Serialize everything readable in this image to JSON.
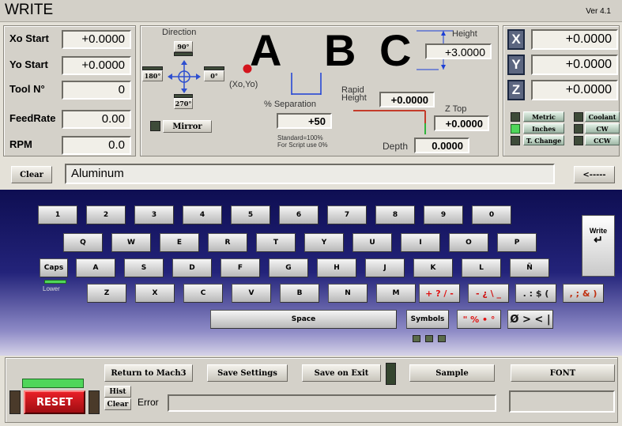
{
  "title": "WRITE",
  "version": "Ver 4.1",
  "left_fields": [
    {
      "label": "Xo Start",
      "value": "+0.0000"
    },
    {
      "label": "Yo Start",
      "value": "+0.0000"
    },
    {
      "label": "Tool N°",
      "value": "0"
    },
    {
      "label": "FeedRate",
      "value": "0.00"
    },
    {
      "label": "RPM",
      "value": "0.0"
    }
  ],
  "direction": {
    "label": "Direction",
    "up": "90°",
    "left": "180°",
    "right": "0°",
    "down": "270°",
    "mirror": "Mirror"
  },
  "preview": {
    "letters": [
      "A",
      "B",
      "C"
    ],
    "origin": "(Xo,Yo)",
    "height_label": "Height",
    "height_value": "+3.0000",
    "separation_label": "% Separation",
    "separation_value": "+50",
    "sep_note1": "Standard=100%",
    "sep_note2": "For Script use 0%",
    "rapid_label1": "Rapid",
    "rapid_label2": "Height",
    "rapid_value": "+0.0000",
    "ztop_label": "Z Top",
    "ztop_value": "+0.0000",
    "depth_label": "Depth",
    "depth_value": "0.0000"
  },
  "axes": [
    {
      "name": "X",
      "value": "+0.0000"
    },
    {
      "name": "Y",
      "value": "+0.0000"
    },
    {
      "name": "Z",
      "value": "+0.0000"
    }
  ],
  "units": {
    "metric": "Metric",
    "inches": "Inches",
    "tchange": "T. Change",
    "coolant": "Coolant",
    "cw": "CW",
    "ccw": "CCW"
  },
  "text_line": {
    "clear": "Clear",
    "value": "Aluminum",
    "back": "<-----"
  },
  "keyboard": {
    "row1": [
      "1",
      "2",
      "3",
      "4",
      "5",
      "6",
      "7",
      "8",
      "9",
      "0"
    ],
    "row2": [
      "Q",
      "W",
      "E",
      "R",
      "T",
      "Y",
      "U",
      "I",
      "O",
      "P"
    ],
    "caps": "Caps",
    "row3": [
      "A",
      "S",
      "D",
      "F",
      "G",
      "H",
      "J",
      "K",
      "L",
      "Ñ"
    ],
    "lower": "Lower",
    "row4": [
      "Z",
      "X",
      "C",
      "V",
      "B",
      "N",
      "M"
    ],
    "space": "Space",
    "symbols": "Symbols",
    "write": "Write",
    "sym1": "+ ? / -",
    "sym2": "- ¿ \\ _",
    "sym3": ". : $ (",
    "sym4": ", ; & )",
    "sym5": "\" % • °",
    "sym6": "Ø > < |"
  },
  "bottom": {
    "return": "Return to Mach3",
    "save_settings": "Save Settings",
    "save_exit": "Save on Exit",
    "sample": "Sample",
    "font": "FONT",
    "reset": "RESET",
    "hist": "Hist",
    "clear": "Clear",
    "error_label": "Error"
  },
  "colors": {
    "accent_red": "#d4151d",
    "led_green": "#4fd65a",
    "keyboard_bg": "#1c1c6e"
  }
}
